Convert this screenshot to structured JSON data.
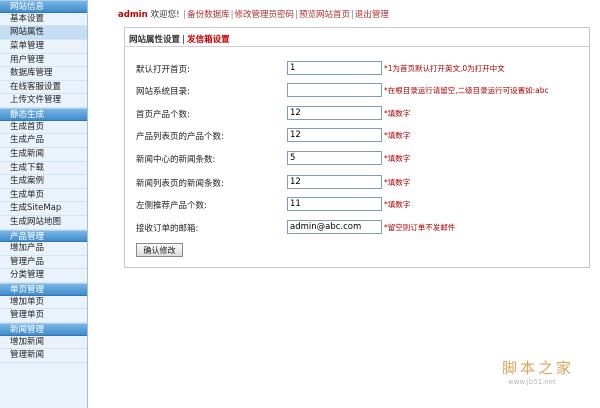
{
  "sidebar": {
    "groups": [
      {
        "title": "网站信息",
        "items": [
          "基本设置",
          "网站属性",
          "菜单管理",
          "用户管理",
          "数据库管理",
          "在线客服设置",
          "上传文件管理"
        ]
      },
      {
        "title": "静态生成",
        "items": [
          "生成首页",
          "生成产品",
          "生成新闻",
          "生成下载",
          "生成案例",
          "生成单页",
          "生成SiteMap",
          "生成网站地图"
        ]
      },
      {
        "title": "产品管理",
        "items": [
          "增加产品",
          "管理产品",
          "分类管理"
        ]
      },
      {
        "title": "单页管理",
        "items": [
          "增加单页",
          "管理单页"
        ]
      },
      {
        "title": "新闻管理",
        "items": [
          "增加新闻",
          "管理新闻"
        ]
      }
    ],
    "active_item": "网站属性"
  },
  "topbar": {
    "username": "admin",
    "welcome": "欢迎您!",
    "links": [
      "备份数据库",
      "修改管理员密码",
      "预览网站首页",
      "退出管理"
    ]
  },
  "panel": {
    "tab_active": "网站属性设置",
    "tab_sep": "|",
    "tab_link": "发信箱设置",
    "fields": [
      {
        "label": "默认打开首页:",
        "value": "1",
        "hint": "*1为首页默认打开英文,0为打开中文"
      },
      {
        "label": "网站系统目录:",
        "value": "",
        "hint": "*在根目录运行请留空,二级目录运行可设置如:abc"
      },
      {
        "label": "首页产品个数:",
        "value": "12",
        "hint": "*填数字"
      },
      {
        "label": "产品列表页的产品个数:",
        "value": "12",
        "hint": "*填数字"
      },
      {
        "label": "新闻中心的新闻条数:",
        "value": "5",
        "hint": "*填数字"
      },
      {
        "label": "新闻列表页的新闻条数:",
        "value": "12",
        "hint": "*填数字"
      },
      {
        "label": "左侧推荐产品个数:",
        "value": "11",
        "hint": "*填数字"
      },
      {
        "label": "接收订单的邮箱:",
        "value": "admin@abc.com",
        "hint": "*留空则订单不发邮件"
      }
    ],
    "submit_label": "确认修改"
  },
  "watermark": {
    "title": "脚本之家",
    "url": "www.jb51.net"
  }
}
